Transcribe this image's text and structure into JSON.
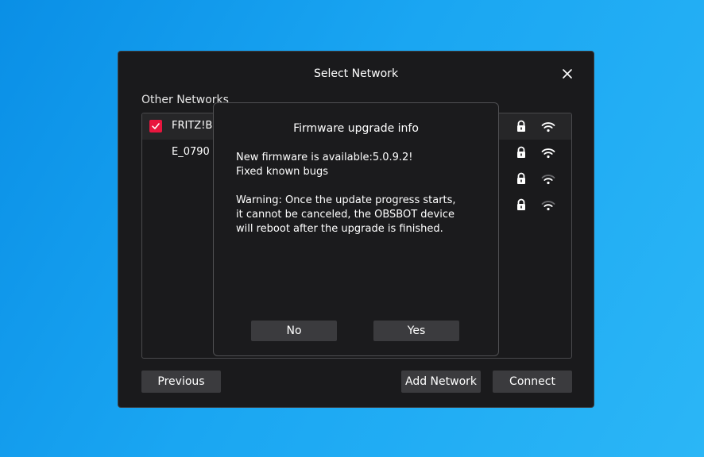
{
  "dialog": {
    "title": "Select Network",
    "section_label": "Other Networks",
    "networks": [
      {
        "name": "FRITZ!B",
        "checked": true,
        "locked": true,
        "signal": "strong"
      },
      {
        "name": "E_0790",
        "checked": false,
        "locked": true,
        "signal": "strong"
      },
      {
        "name": "",
        "checked": false,
        "locked": true,
        "signal": "weak"
      },
      {
        "name": "",
        "checked": false,
        "locked": true,
        "signal": "weak"
      }
    ],
    "buttons": {
      "previous": "Previous",
      "add_network": "Add Network",
      "connect": "Connect"
    }
  },
  "modal": {
    "title": "Firmware upgrade info",
    "line1": "New firmware is available:5.0.9.2!",
    "line2": "Fixed known bugs",
    "warning1": "Warning: Once the update progress starts,",
    "warning2": "it cannot be canceled, the OBSBOT device",
    "warning3": "will reboot after the upgrade is finished.",
    "no_label": "No",
    "yes_label": "Yes"
  },
  "colors": {
    "accent": "#e8163e",
    "dialog_bg": "#1a1a1c",
    "button_bg": "#3b3b3e",
    "desktop": "#1aa6f2"
  },
  "icons": [
    "close-icon",
    "check-icon",
    "lock-icon",
    "wifi-icon"
  ]
}
